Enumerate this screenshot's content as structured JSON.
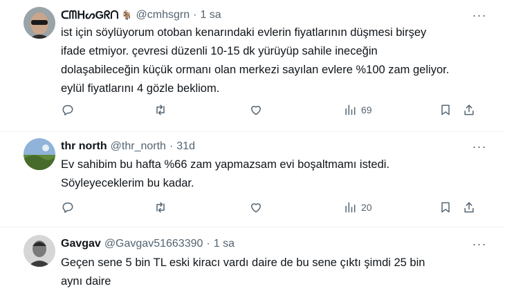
{
  "tweets": [
    {
      "display_name": "ᑕᗰᕼᔕGᖇᑎ",
      "badge": "🐐",
      "handle": "@cmhsgrn",
      "separator": "·",
      "time": "1 sa",
      "more": "···",
      "text": [
        "ist için söylüyorum otoban kenarındaki evlerin fiyatlarının düşmesi birşey",
        "ifade etmiyor. çevresi düzenli 10-15 dk yürüyüp sahile ineceğin",
        "dolaşabileceğin küçük ormanı olan merkezi sayılan evlere %100 zam geliyor.",
        "eylül fiyatlarını 4 gözle bekliom."
      ],
      "views": "69"
    },
    {
      "display_name": "thr north",
      "handle": "@thr_north",
      "separator": "·",
      "time": "31d",
      "more": "···",
      "text": [
        "Ev sahibim bu hafta %66 zam yapmazsam evi boşaltmamı istedi.",
        "Söyleyeceklerim bu kadar."
      ],
      "views": "20"
    },
    {
      "display_name": "Gavgav",
      "handle": "@Gavgav51663390",
      "separator": "·",
      "time": "1 sa",
      "more": "···",
      "text": [
        "Geçen sene 5 bin TL  eski kiracı  vardı daire de bu sene çıktı şimdi 25 bin",
        "aynı daire"
      ]
    }
  ],
  "icons": {
    "reply": "reply-icon",
    "retweet": "retweet-icon",
    "like": "like-icon",
    "views": "views-icon",
    "bookmark": "bookmark-icon",
    "share": "share-icon"
  },
  "colors": {
    "text": "#0f1419",
    "secondary": "#536471",
    "divider": "#eff3f4"
  }
}
